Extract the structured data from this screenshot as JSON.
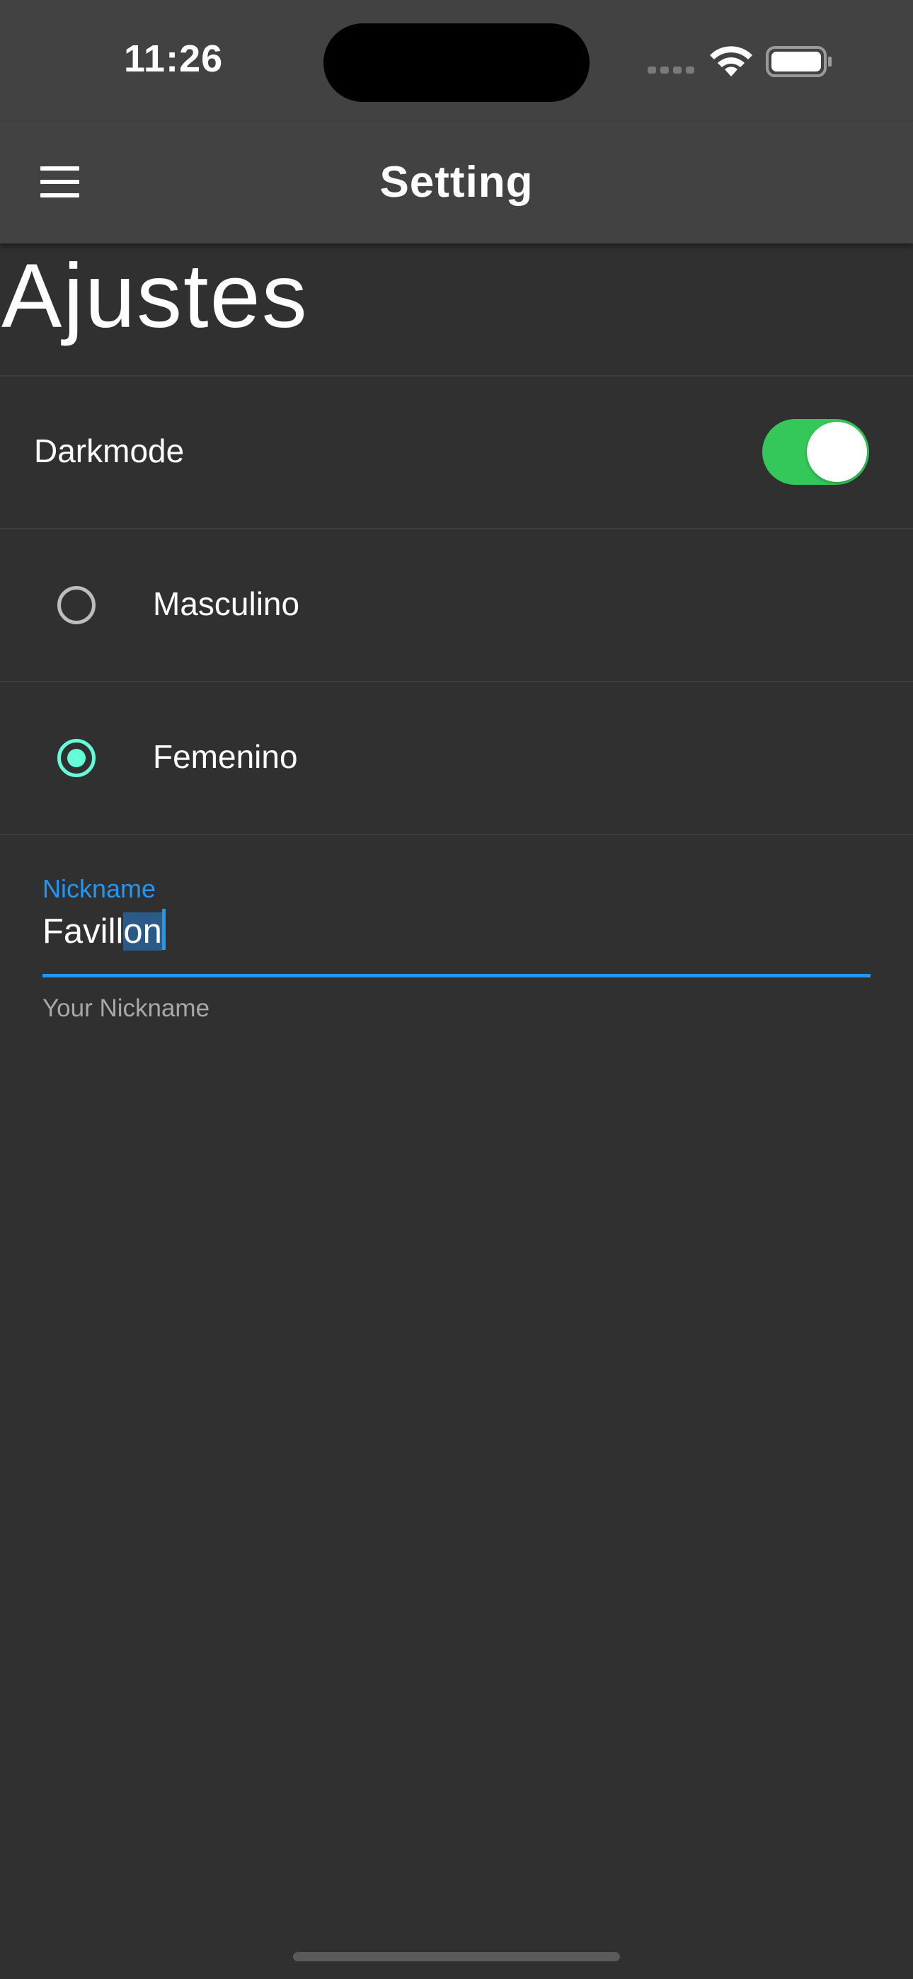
{
  "status_bar": {
    "time": "11:26",
    "icons": [
      "cellular-signal-icon",
      "wifi-icon",
      "battery-icon"
    ]
  },
  "app_bar": {
    "title": "Setting",
    "menu_icon": "hamburger-menu-icon"
  },
  "page": {
    "heading": "Ajustes"
  },
  "settings": {
    "darkmode": {
      "label": "Darkmode",
      "enabled": true,
      "accent": "#34C759"
    },
    "gender": {
      "options": [
        {
          "label": "Masculino",
          "selected": false
        },
        {
          "label": "Femenino",
          "selected": true
        }
      ],
      "accent": "#64FFDA"
    },
    "nickname": {
      "label": "Nickname",
      "value_unselected": "Favill",
      "value_selected": "on",
      "helper": "Your Nickname",
      "accent": "#2196F3"
    }
  },
  "colors": {
    "background": "#303030",
    "app_bar": "#424242"
  }
}
